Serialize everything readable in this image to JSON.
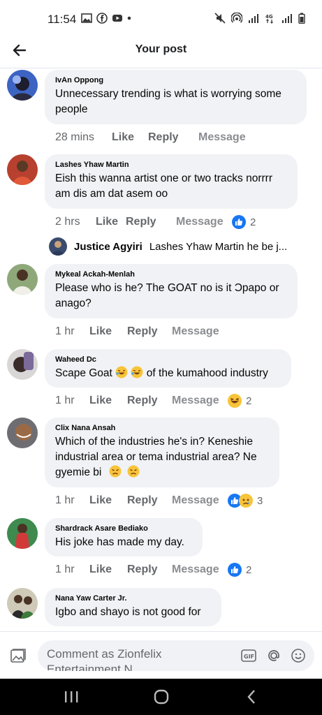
{
  "status": {
    "time": "11:54"
  },
  "header": {
    "title": "Your post"
  },
  "comments": [
    {
      "author": "IvAn Oppong",
      "text": "Unnecessary trending is what is worrying some people",
      "time": "28 mins",
      "reactions": ""
    },
    {
      "author": "Lashes Yhaw Martin",
      "text": "Eish this wanna artist one or two tracks norrrr am dis am dat asem oo",
      "time": "2 hrs",
      "reactions": "2"
    },
    {
      "author": "Mykeal Ackah-Menlah",
      "text": "Please who is he? The GOAT no is it Ɔpapo or anago?",
      "time": "1 hr",
      "reactions": ""
    },
    {
      "author": "Waheed Dc",
      "text_before": "Scape Goat",
      "text_after": "of the kumahood industry",
      "time": "1 hr",
      "reactions": "2"
    },
    {
      "author": "Clix Nana Ansah",
      "text_line1": "Which of the industries he's in? Keneshie",
      "text_line2": "industrial area or tema industrial area? Ne",
      "text_line3": "gyemie bi",
      "time": "1 hr",
      "reactions": "3"
    },
    {
      "author": "Shardrack Asare Bediako",
      "text": "His joke has made my day.",
      "time": "1 hr",
      "reactions": "2"
    },
    {
      "author": "Nana Yaw Carter Jr.",
      "text": "Igbo and shayo is not good for"
    }
  ],
  "reply_preview": {
    "author": "Justice Agyiri",
    "text": "Lashes Yhaw Martin he be j..."
  },
  "actions": {
    "like": "Like",
    "reply": "Reply",
    "message": "Message"
  },
  "composer": {
    "placeholder": "Comment as Zionfelix",
    "placeholder_line2": "Entertainment N..."
  },
  "colors": {
    "like_blue": "#1877f2",
    "bubble": "#f0f2f5",
    "muted": "#65676b"
  }
}
